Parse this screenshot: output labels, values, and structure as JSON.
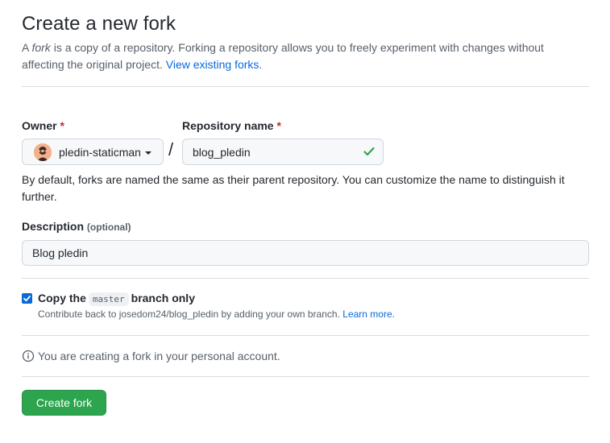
{
  "header": {
    "title": "Create a new fork",
    "intro_prefix": "A ",
    "intro_emphasis": "fork",
    "intro_middle": " is a copy of a repository. Forking a repository allows you to freely experiment with changes without affecting the original project. ",
    "intro_link": "View existing forks."
  },
  "owner": {
    "label": "Owner",
    "required_mark": "*",
    "value": "pledin-staticman",
    "icon": "chevron-down-icon"
  },
  "separator": "/",
  "repository": {
    "label": "Repository name",
    "required_mark": "*",
    "value": "blog_pledin",
    "status_icon": "check-icon"
  },
  "naming_help": "By default, forks are named the same as their parent repository. You can customize the name to distinguish it further.",
  "description": {
    "label": "Description",
    "optional": "(optional)",
    "value": "Blog pledin"
  },
  "copy_branch": {
    "checked": true,
    "label_prefix": "Copy the",
    "branch": "master",
    "label_suffix": "branch only",
    "note": "Contribute back to josedom24/blog_pledin by adding your own branch.",
    "note_link": "Learn more."
  },
  "info": {
    "icon": "info-icon",
    "text": "You are creating a fork in your personal account."
  },
  "actions": {
    "create_label": "Create fork"
  },
  "colors": {
    "primary_button": "#2da44e",
    "link": "#0969da",
    "required": "#cf222e",
    "check": "#2da44e"
  }
}
